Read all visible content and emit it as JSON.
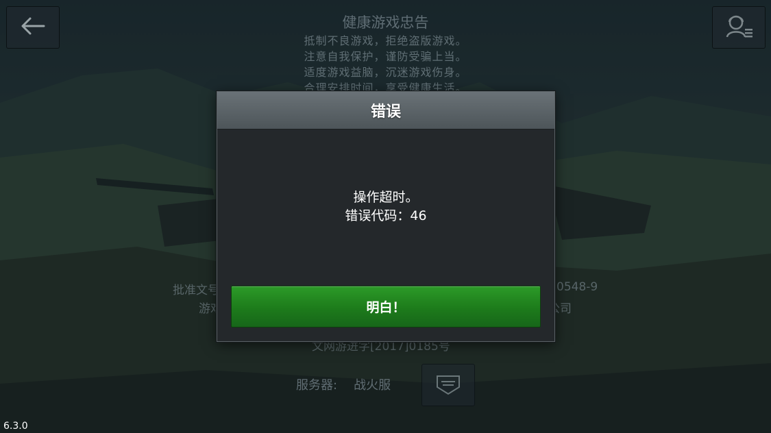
{
  "version": "6.3.0",
  "notice": {
    "title": "健康游戏忠告",
    "lines": [
      "抵制不良游戏，拒绝盗版游戏。",
      "注意自我保护，谨防受骗上当。",
      "适度游戏益脑，沉迷游戏伤身。",
      "合理安排时间，享受健康生活。"
    ]
  },
  "background_text": {
    "left_line_1": "批准文号",
    "right_line_1": "0548-9",
    "left_line_2": "游戏",
    "right_line_2": "公司",
    "license": "文网游进字[2017]0185号"
  },
  "server": {
    "label": "服务器:",
    "value": "战火服"
  },
  "dialog": {
    "title": "错误",
    "message_line_1": "操作超时。",
    "message_line_2": "错误代码：46",
    "ok_label": "明白！"
  },
  "icons": {
    "back": "arrow-left-icon",
    "support": "support-agent-icon",
    "server": "server-emblem-icon"
  },
  "colors": {
    "ok_button": "#1d7b1b",
    "dialog_body": "#24282b",
    "dialog_header": "#5b6368"
  }
}
